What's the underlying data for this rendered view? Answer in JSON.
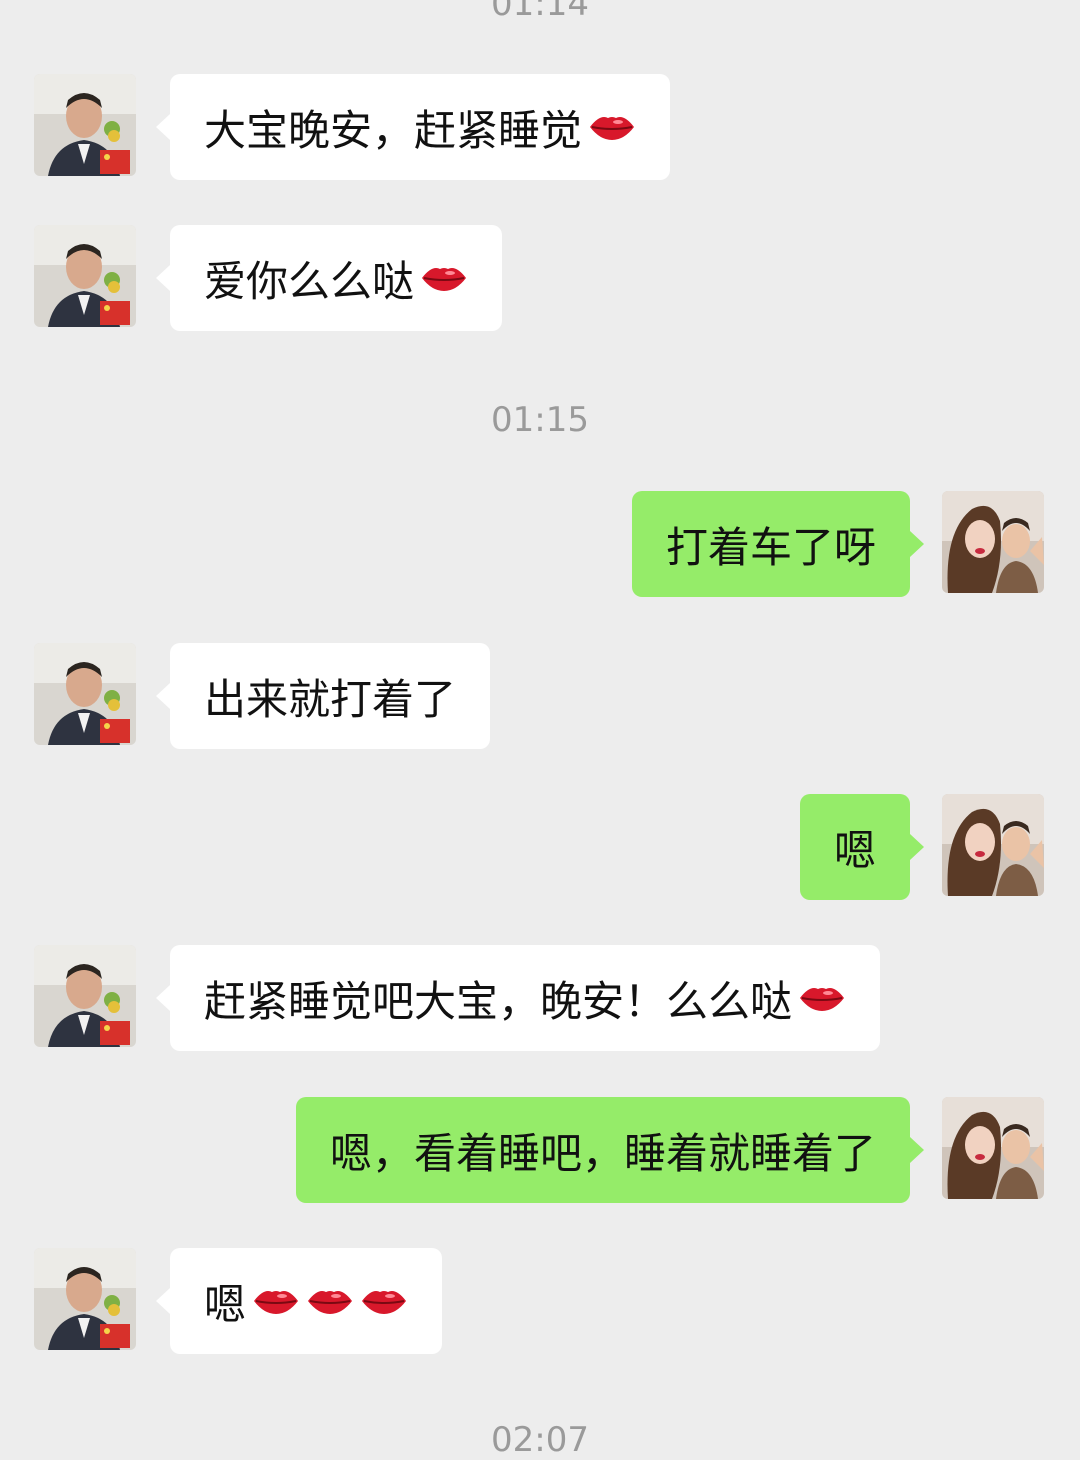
{
  "timestamps": {
    "top_partial": "01:14",
    "middle": "01:15",
    "bottom_partial": "02:07"
  },
  "messages": [
    {
      "side": "in",
      "text": "大宝晚安，赶紧睡觉",
      "emoji_count": 1,
      "emoji": "lips-icon"
    },
    {
      "side": "in",
      "text": "爱你么么哒",
      "emoji_count": 1,
      "emoji": "lips-icon"
    },
    {
      "side": "out",
      "text": "打着车了呀",
      "emoji_count": 0
    },
    {
      "side": "in",
      "text": "出来就打着了",
      "emoji_count": 0
    },
    {
      "side": "out",
      "text": "嗯",
      "emoji_count": 0
    },
    {
      "side": "in",
      "text": "赶紧睡觉吧大宝，晚安！么么哒",
      "emoji_count": 1,
      "emoji": "lips-icon"
    },
    {
      "side": "out",
      "text": "嗯，看着睡吧，睡着就睡着了",
      "emoji_count": 0
    },
    {
      "side": "in",
      "text": "嗯",
      "emoji_count": 3,
      "emoji": "lips-icon"
    }
  ],
  "colors": {
    "background": "#ededed",
    "incoming_bubble": "#ffffff",
    "outgoing_bubble": "#95ec69",
    "timestamp_text": "#9a9a9a"
  }
}
